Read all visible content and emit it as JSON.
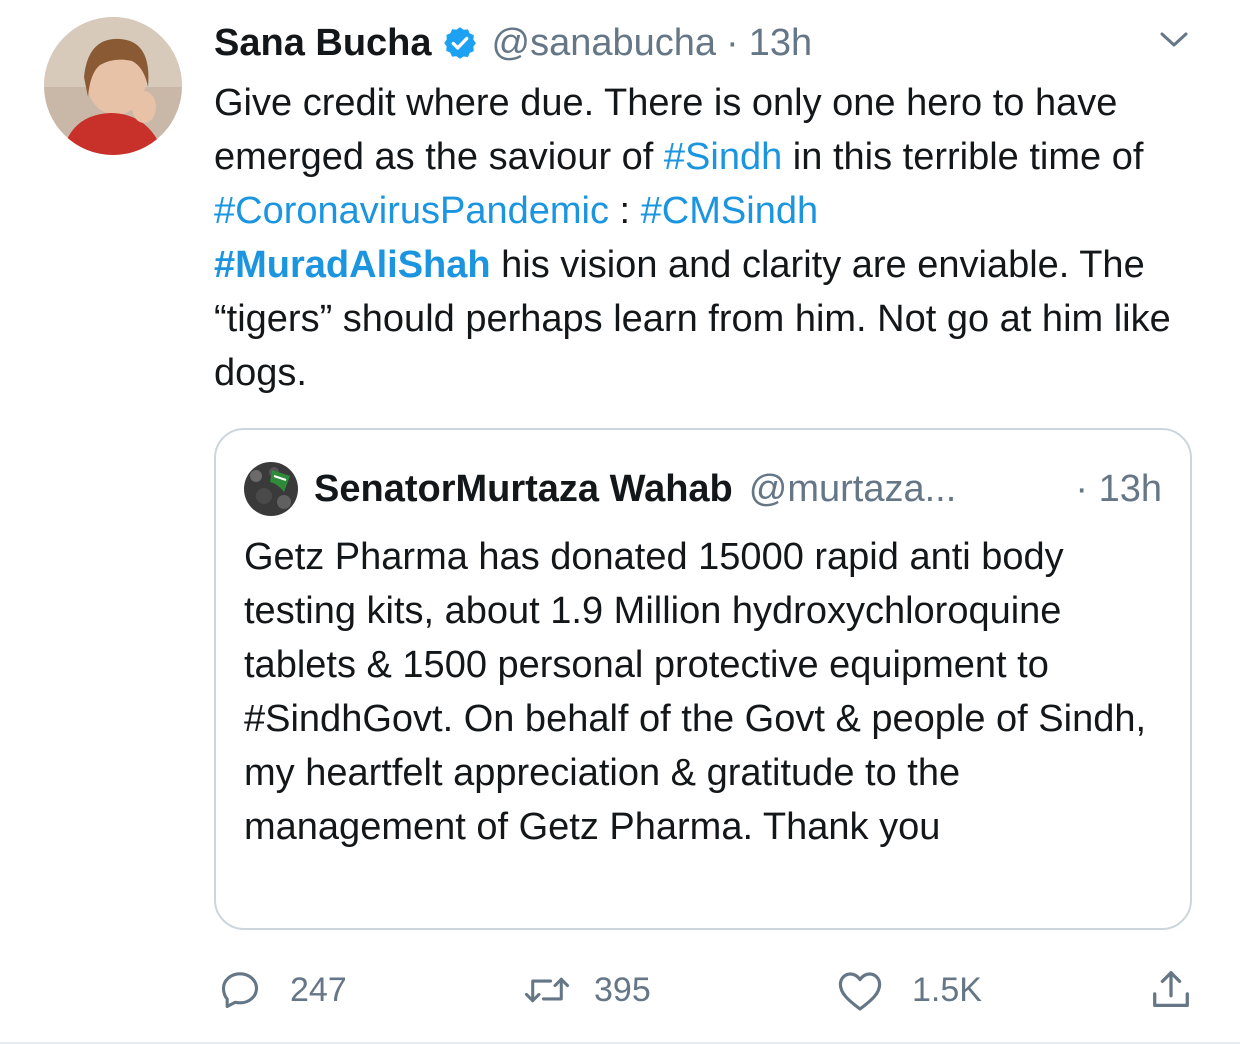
{
  "tweet": {
    "author_name": "Sana Bucha",
    "author_handle": "@sanabucha",
    "separator": "·",
    "time": "13h",
    "text": {
      "p1": "Give credit where due. There is only one hero to have emerged as the saviour of ",
      "tag_sindh": "#Sindh",
      "p2": " in this terrible time of ",
      "tag_corona": "#CoronavirusPandemic",
      "p3": " : ",
      "tag_cmsindh": "#CMSindh",
      "tag_murad": "#MuradAliShah",
      "p4": " his vision and clarity are enviable. The “tigers” should perhaps learn from him. Not go at him like dogs."
    }
  },
  "quoted_tweet": {
    "author_name": "SenatorMurtaza Wahab",
    "author_handle": "@murtaza...",
    "time": "· 13h",
    "text": "Getz Pharma has donated 15000 rapid anti body testing kits, about 1.9 Million hydroxychloroquine tablets & 1500 personal protective equipment to #SindhGovt. On behalf of the Govt & people of Sindh, my heartfelt appreciation & gratitude to the management of Getz Pharma. Thank you"
  },
  "actions": {
    "replies": "247",
    "retweets": "395",
    "likes": "1.5K"
  },
  "colors": {
    "link": "#1b95e0",
    "muted": "#657786",
    "border": "#ccd6dd"
  },
  "icons": [
    "verified-badge-icon",
    "chevron-down-icon",
    "reply-icon",
    "retweet-icon",
    "like-icon",
    "share-icon"
  ]
}
